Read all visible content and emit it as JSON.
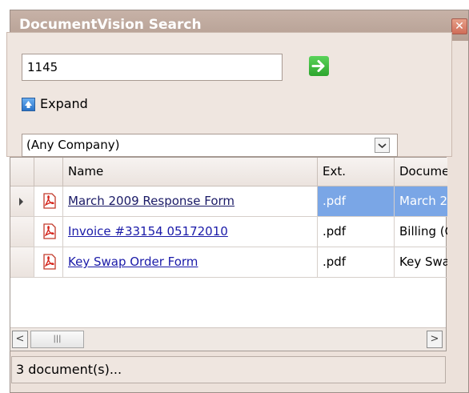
{
  "window": {
    "title": "DocumentVision Search",
    "close_icon": "close-icon"
  },
  "search": {
    "value": "1145",
    "go_icon": "green-arrow-right-icon"
  },
  "expand": {
    "label": "Expand",
    "icon": "expand-up-icon"
  },
  "company_filter": {
    "selected": "(Any Company)"
  },
  "grid": {
    "columns": [
      "Name",
      "Ext.",
      "Docume"
    ],
    "rows": [
      {
        "name": "March 2009 Response Form",
        "ext": ".pdf",
        "doc": "March 2",
        "selected": true
      },
      {
        "name": "Invoice #33154 05172010",
        "ext": ".pdf",
        "doc": "Billing (C",
        "selected": false
      },
      {
        "name": "Key Swap Order Form",
        "ext": ".pdf",
        "doc": "Key Swa",
        "selected": false
      }
    ]
  },
  "status": {
    "text": "3 document(s)..."
  },
  "colors": {
    "titlebar": "#b59f93",
    "selection": "#7aa6e6",
    "link": "#1a1aa8"
  }
}
